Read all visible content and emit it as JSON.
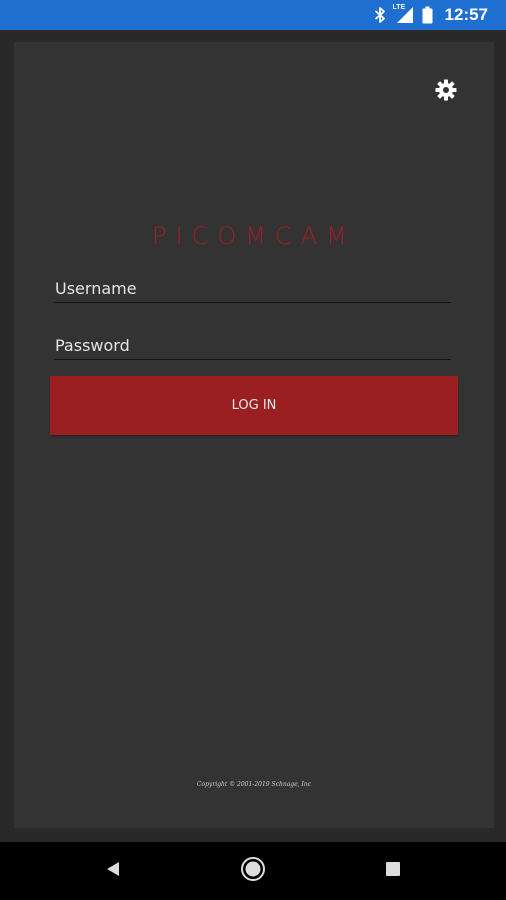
{
  "status_bar": {
    "time": "12:57",
    "network_label": "LTE",
    "icons": [
      "bluetooth-icon",
      "lte-signal-icon",
      "battery-icon"
    ],
    "background": "#1e6fd0"
  },
  "app": {
    "title": "PICOMCAM",
    "settings_icon": "gear-icon",
    "username_placeholder": "Username",
    "password_placeholder": "Password",
    "login_label": "LOG IN",
    "copyright": "Copyright © 2001-2019 Schnage, Inc",
    "accent_color": "#9b1f21",
    "card_color": "#333333"
  },
  "nav_bar": {
    "icons": [
      "back-icon",
      "home-icon",
      "recents-icon"
    ]
  }
}
